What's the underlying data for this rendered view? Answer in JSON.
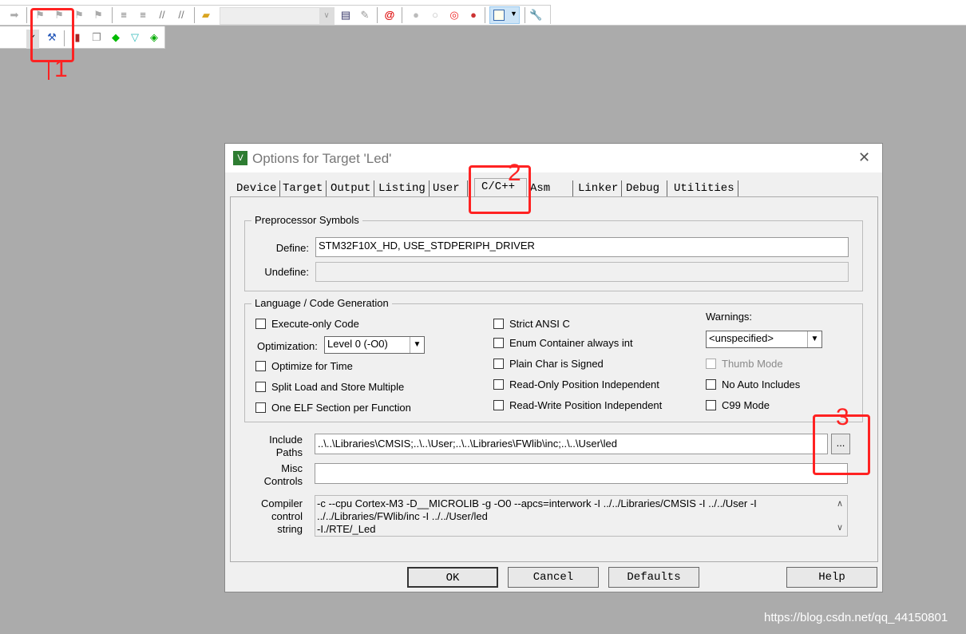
{
  "toolbar": {
    "icons": [
      "forward-icon",
      "bookmark-icon",
      "prev-bookmark-icon",
      "next-bookmark-icon",
      "clear-bookmarks-icon",
      "indent-icon",
      "unindent-icon",
      "comment-icon",
      "uncomment-icon",
      "open-file-icon",
      "find-in-files-icon",
      "incremental-find-icon",
      "debug-session-icon",
      "breakpoint-icon",
      "disable-breakpoint-icon",
      "disable-all-breakpoints-icon",
      "kill-breakpoints-icon",
      "window-layout-icon",
      "configure-icon"
    ],
    "row2_icons": [
      "target-options-icon",
      "file-extensions-icon",
      "manage-rte-icon",
      "select-software-packs-icon",
      "pack-installer-icon"
    ]
  },
  "dialog": {
    "title": "Options for Target 'Led'",
    "close": "✕",
    "tabs": [
      "Device",
      "Target",
      "Output",
      "Listing",
      "User",
      "C/C++",
      "Asm",
      "Linker",
      "Debug",
      "Utilities"
    ],
    "active_tab": "C/C++",
    "preprocessor": {
      "label": "Preprocessor Symbols",
      "define_label": "Define:",
      "define_value": "STM32F10X_HD, USE_STDPERIPH_DRIVER",
      "undefine_label": "Undefine:",
      "undefine_value": ""
    },
    "language": {
      "label": "Language / Code Generation",
      "execute_only": "Execute-only Code",
      "optimization_label": "Optimization:",
      "optimization_value": "Level 0 (-O0)",
      "optimize_time": "Optimize for Time",
      "split_load": "Split Load and Store Multiple",
      "one_elf": "One ELF Section per Function",
      "strict_ansi": "Strict ANSI C",
      "enum_container": "Enum Container always int",
      "plain_char": "Plain Char is Signed",
      "ro_pi": "Read-Only Position Independent",
      "rw_pi": "Read-Write Position Independent",
      "warnings_label": "Warnings:",
      "warnings_value": "<unspecified>",
      "thumb_mode": "Thumb Mode",
      "no_auto_includes": "No Auto Includes",
      "c99": "C99 Mode"
    },
    "include_label_1": "Include",
    "include_label_2": "Paths",
    "include_value": "..\\..\\Libraries\\CMSIS;..\\..\\User;..\\..\\Libraries\\FWlib\\inc;..\\..\\User\\led",
    "browse": "...",
    "misc_label_1": "Misc",
    "misc_label_2": "Controls",
    "misc_value": "",
    "compiler_label_1": "Compiler",
    "compiler_label_2": "control",
    "compiler_label_3": "string",
    "compiler_lines": [
      "-c --cpu Cortex-M3 -D__MICROLIB -g -O0 --apcs=interwork -I ../../Libraries/CMSIS -I ../../User -I",
      "../../Libraries/FWlib/inc -I ../../User/led",
      "-I./RTE/_Led"
    ],
    "buttons": {
      "ok": "OK",
      "cancel": "Cancel",
      "defaults": "Defaults",
      "help": "Help"
    }
  },
  "annotations": [
    "1",
    "2",
    "3"
  ],
  "watermark": "https://blog.csdn.net/qq_44150801",
  "colors": {
    "annotation": "#ff2222",
    "background": "#ababab"
  }
}
